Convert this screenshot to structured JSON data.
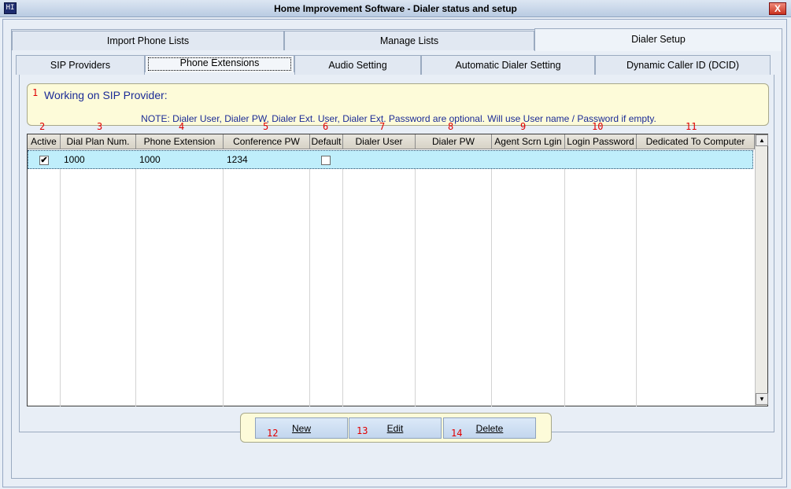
{
  "window": {
    "title": "Home Improvement Software - Dialer status and setup",
    "close_label": "X",
    "icon_label": "HI"
  },
  "main_tabs": [
    {
      "label": "Import Phone Lists"
    },
    {
      "label": "Manage Lists"
    },
    {
      "label": "Dialer Setup",
      "active": true
    }
  ],
  "sub_tabs": [
    {
      "label": "SIP Providers"
    },
    {
      "label": "Phone Extensions",
      "active": true
    },
    {
      "label": "Audio Setting"
    },
    {
      "label": "Automatic Dialer Setting"
    },
    {
      "label": "Dynamic Caller ID (DCID)"
    }
  ],
  "info": {
    "title": "Working on SIP Provider:",
    "note": "NOTE: Dialer User, Dialer PW, Dialer Ext. User, Dialer Ext. Password are optional. Will use User name / Password if empty."
  },
  "annotations": [
    "1",
    "2",
    "3",
    "4",
    "5",
    "6",
    "7",
    "8",
    "9",
    "10",
    "11",
    "12",
    "13",
    "14"
  ],
  "grid": {
    "columns": [
      "Active",
      "Dial Plan Num.",
      "Phone Extension",
      "Conference PW",
      "Default",
      "Dialer User",
      "Dialer PW",
      "Agent Scrn Lgin",
      "Login Password",
      "Dedicated To Computer"
    ],
    "rows": [
      {
        "active": true,
        "dial_plan": "1000",
        "extension": "1000",
        "conference_pw": "1234",
        "default": false,
        "dialer_user": "",
        "dialer_pw": "",
        "agent_login": "",
        "login_password": "",
        "dedicated_to": ""
      }
    ]
  },
  "buttons": {
    "new": "New",
    "edit": "Edit",
    "delete": "Delete"
  },
  "colors": {
    "accent_blue": "#1b2b96",
    "annotation_red": "#e00000",
    "row_highlight": "#bfeefb",
    "note_bg": "#fdfbd9"
  }
}
